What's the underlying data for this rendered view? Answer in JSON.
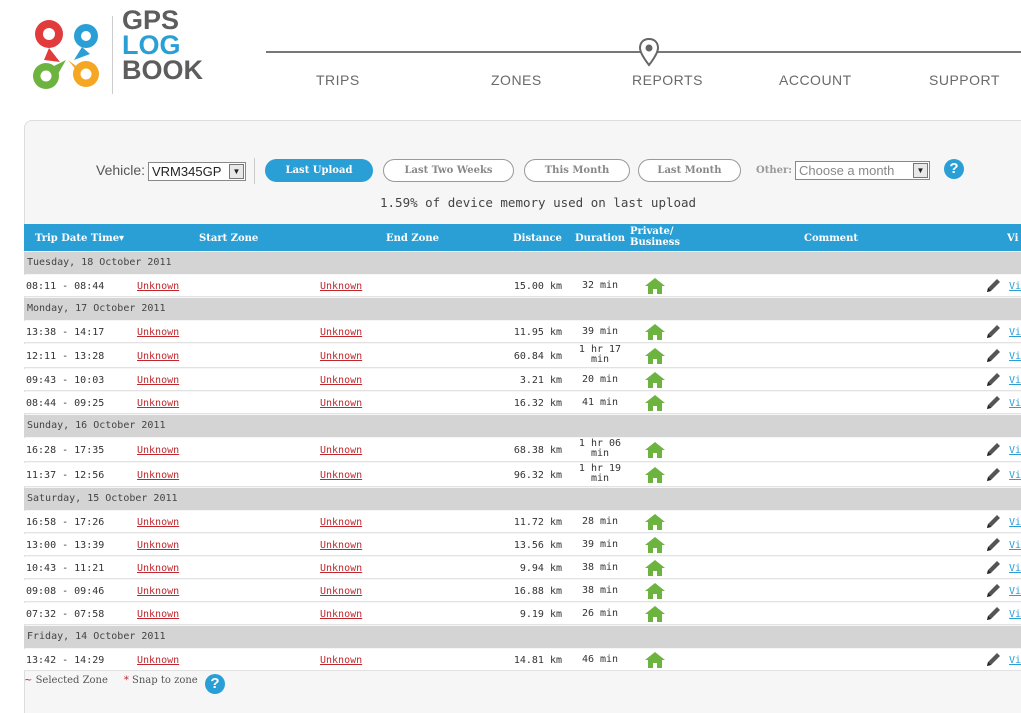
{
  "header": {
    "logo_lines": [
      "GPS",
      "LOG",
      "BOOK"
    ],
    "nav": [
      "TRIPS",
      "ZONES",
      "REPORTS",
      "ACCOUNT",
      "SUPPORT"
    ]
  },
  "filters": {
    "vehicle_label": "Vehicle:",
    "vehicle_value": "VRM345GP",
    "buttons": [
      "Last Upload",
      "Last Two Weeks",
      "This Month",
      "Last Month"
    ],
    "active_button": "Last Upload",
    "other_label": "Other:",
    "other_placeholder": "Choose a month",
    "help": "?"
  },
  "memory_text": "1.59% of device memory used on last upload",
  "table": {
    "columns": {
      "date_time": "Trip Date Time▾",
      "start_zone": "Start Zone",
      "end_zone": "End Zone",
      "distance": "Distance",
      "duration": "Duration",
      "private_business": "Private/ Business",
      "comment": "Comment",
      "view": "Vi"
    },
    "groups": [
      {
        "date": "Tuesday, 18 October 2011",
        "trips": [
          {
            "time": "08:11 - 08:44",
            "start": "Unknown",
            "end": "Unknown",
            "distance": "15.00 km",
            "duration": "32 min",
            "view": "Vi"
          }
        ]
      },
      {
        "date": "Monday, 17 October 2011",
        "trips": [
          {
            "time": "13:38 - 14:17",
            "start": "Unknown",
            "end": "Unknown",
            "distance": "11.95 km",
            "duration": "39 min",
            "view": "Vi"
          },
          {
            "time": "12:11 - 13:28",
            "start": "Unknown",
            "end": "Unknown",
            "distance": "60.84 km",
            "duration": "1 hr 17 min",
            "view": "Vi"
          },
          {
            "time": "09:43 - 10:03",
            "start": "Unknown",
            "end": "Unknown",
            "distance": "3.21 km",
            "duration": "20 min",
            "view": "Vi"
          },
          {
            "time": "08:44 - 09:25",
            "start": "Unknown",
            "end": "Unknown",
            "distance": "16.32 km",
            "duration": "41 min",
            "view": "Vi"
          }
        ]
      },
      {
        "date": "Sunday, 16 October 2011",
        "trips": [
          {
            "time": "16:28 - 17:35",
            "start": "Unknown",
            "end": "Unknown",
            "distance": "68.38 km",
            "duration": "1 hr 06 min",
            "view": "Vi"
          },
          {
            "time": "11:37 - 12:56",
            "start": "Unknown",
            "end": "Unknown",
            "distance": "96.32 km",
            "duration": "1 hr 19 min",
            "view": "Vi"
          }
        ]
      },
      {
        "date": "Saturday, 15 October 2011",
        "trips": [
          {
            "time": "16:58 - 17:26",
            "start": "Unknown",
            "end": "Unknown",
            "distance": "11.72 km",
            "duration": "28 min",
            "view": "Vi"
          },
          {
            "time": "13:00 - 13:39",
            "start": "Unknown",
            "end": "Unknown",
            "distance": "13.56 km",
            "duration": "39 min",
            "view": "Vi"
          },
          {
            "time": "10:43 - 11:21",
            "start": "Unknown",
            "end": "Unknown",
            "distance": "9.94 km",
            "duration": "38 min",
            "view": "Vi"
          },
          {
            "time": "09:08 - 09:46",
            "start": "Unknown",
            "end": "Unknown",
            "distance": "16.88 km",
            "duration": "38 min",
            "view": "Vi"
          },
          {
            "time": "07:32 - 07:58",
            "start": "Unknown",
            "end": "Unknown",
            "distance": "9.19 km",
            "duration": "26 min",
            "view": "Vi"
          }
        ]
      },
      {
        "date": "Friday, 14 October 2011",
        "trips": [
          {
            "time": "13:42 - 14:29",
            "start": "Unknown",
            "end": "Unknown",
            "distance": "14.81 km",
            "duration": "46 min",
            "view": "Vi"
          }
        ]
      }
    ]
  },
  "legend": {
    "selected_zone_mark": "~",
    "selected_zone": "Selected Zone",
    "snap_mark": "*",
    "snap": "Snap to zone",
    "help": "?"
  },
  "colors": {
    "accent": "#2a9fd6",
    "link_red": "#c0282d",
    "house_green": "#6db33f",
    "group_bg": "#d4d4d4"
  }
}
